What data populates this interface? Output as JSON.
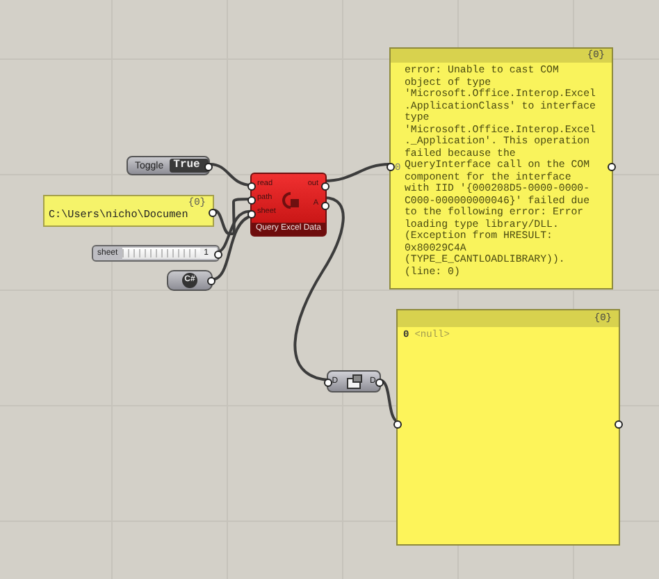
{
  "toggle": {
    "label": "Toggle",
    "value": "True"
  },
  "path_panel": {
    "count": "{0}",
    "text": "C:\\Users\\nicho\\Documen"
  },
  "slider": {
    "label": "sheet",
    "value": "1",
    "level": 1
  },
  "script_node": {
    "label": "C#"
  },
  "component": {
    "title": "Query Excel Data",
    "inputs": [
      "read",
      "path",
      "sheet"
    ],
    "outputs": [
      "out",
      "A"
    ]
  },
  "error_panel": {
    "count": "{0}",
    "index": "0",
    "text": "error: Unable to cast COM\nobject of type\n'Microsoft.Office.Interop.Excel\n.ApplicationClass' to interface\ntype\n'Microsoft.Office.Interop.Excel\n._Application'. This operation\nfailed because the\nQueryInterface call on the COM\ncomponent for the interface\nwith IID '{000208D5-0000-0000-\nC000-000000000046}' failed due\nto the following error: Error\nloading type library/DLL.\n(Exception from HRESULT:\n0x80029C4A\n(TYPE_E_CANTLOADLIBRARY)).\n(line: 0)"
  },
  "null_panel": {
    "count": "{0}",
    "index": "0",
    "text": "<null>"
  },
  "data_node": {
    "input": "D",
    "output": "D"
  }
}
